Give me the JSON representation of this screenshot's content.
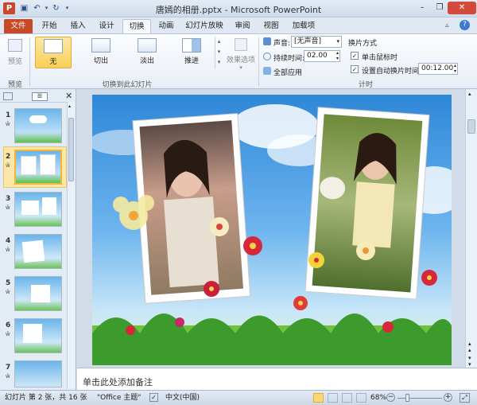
{
  "window": {
    "title": "唐嫣的相册.pptx - Microsoft PowerPoint"
  },
  "tabs": [
    {
      "label": "文件"
    },
    {
      "label": "开始"
    },
    {
      "label": "插入"
    },
    {
      "label": "设计"
    },
    {
      "label": "切换"
    },
    {
      "label": "动画"
    },
    {
      "label": "幻灯片放映"
    },
    {
      "label": "审阅"
    },
    {
      "label": "视图"
    },
    {
      "label": "加载项"
    }
  ],
  "ribbon": {
    "preview_label": "预览",
    "preview_group": "预览",
    "transitions": [
      {
        "label": "无"
      },
      {
        "label": "切出"
      },
      {
        "label": "淡出"
      },
      {
        "label": "推进"
      }
    ],
    "transition_group": "切换到此幻灯片",
    "effect_options": "效果选项",
    "sound_label": "声音:",
    "sound_value": "[无声音]",
    "duration_label": "持续时间:",
    "duration_value": "02.00",
    "apply_all": "全部应用",
    "advance_title": "换片方式",
    "on_click": "单击鼠标时",
    "after_label": "设置自动换片时间:",
    "after_value": "00:12.00",
    "timing_group": "计时"
  },
  "slides": [
    {
      "num": "1",
      "star": "ŵ"
    },
    {
      "num": "2",
      "star": "ŵ"
    },
    {
      "num": "3",
      "star": "ŵ"
    },
    {
      "num": "4",
      "star": "ŵ"
    },
    {
      "num": "5",
      "star": "ŵ"
    },
    {
      "num": "6",
      "star": "ŵ"
    },
    {
      "num": "7",
      "star": "ŵ"
    }
  ],
  "notes": {
    "placeholder": "单击此处添加备注"
  },
  "status": {
    "slide_info": "幻灯片 第 2 张，共 16 张",
    "theme": "\"Office 主题\"",
    "language": "中文(中国)",
    "zoom": "68%"
  },
  "colors": {
    "file_tab": "#c84925",
    "accent": "#f8cf5a",
    "sky": "#4a9fe0"
  }
}
